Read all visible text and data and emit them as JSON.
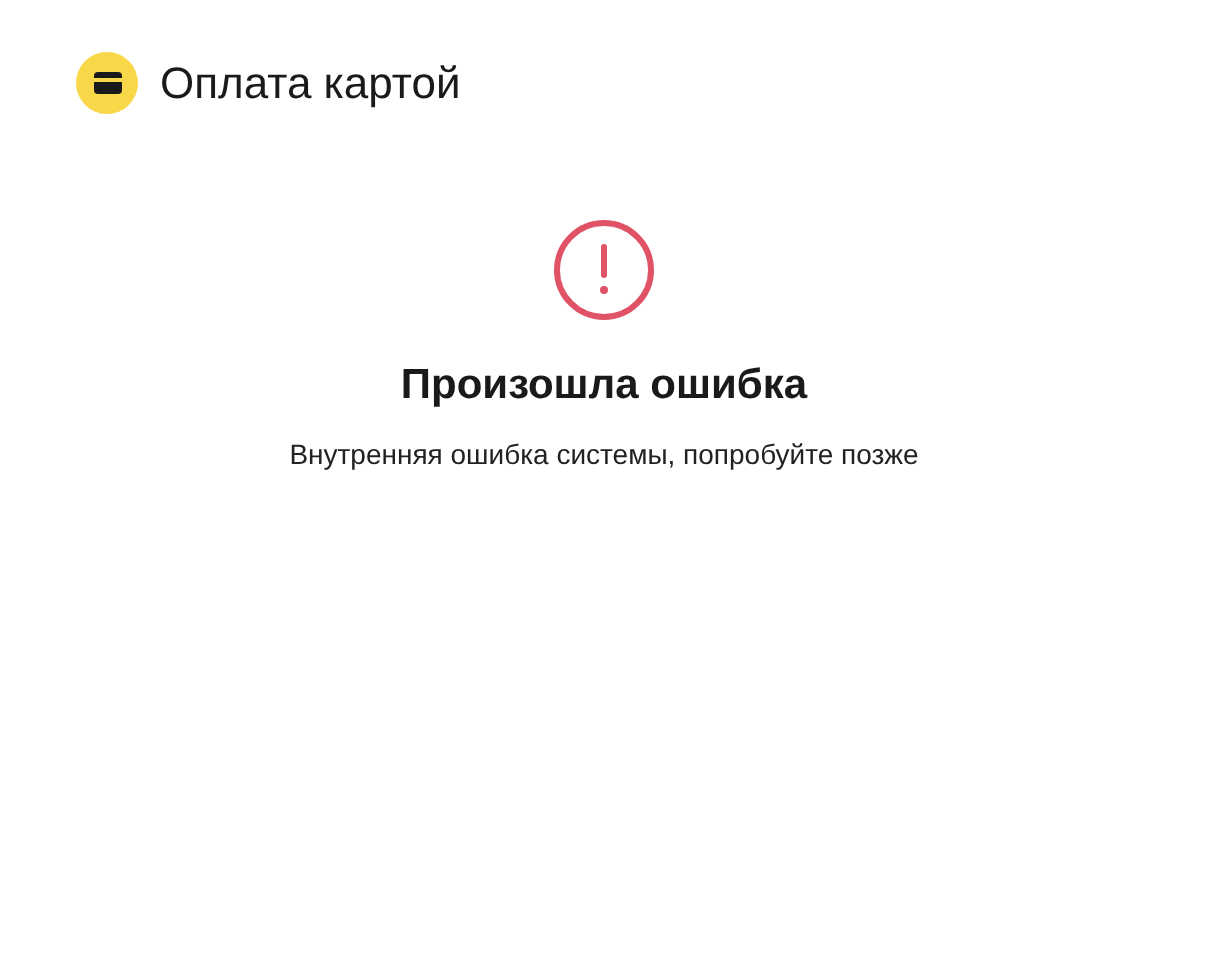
{
  "header": {
    "title": "Оплата картой"
  },
  "error": {
    "title": "Произошла ошибка",
    "message": "Внутренняя ошибка системы, попробуйте позже"
  }
}
